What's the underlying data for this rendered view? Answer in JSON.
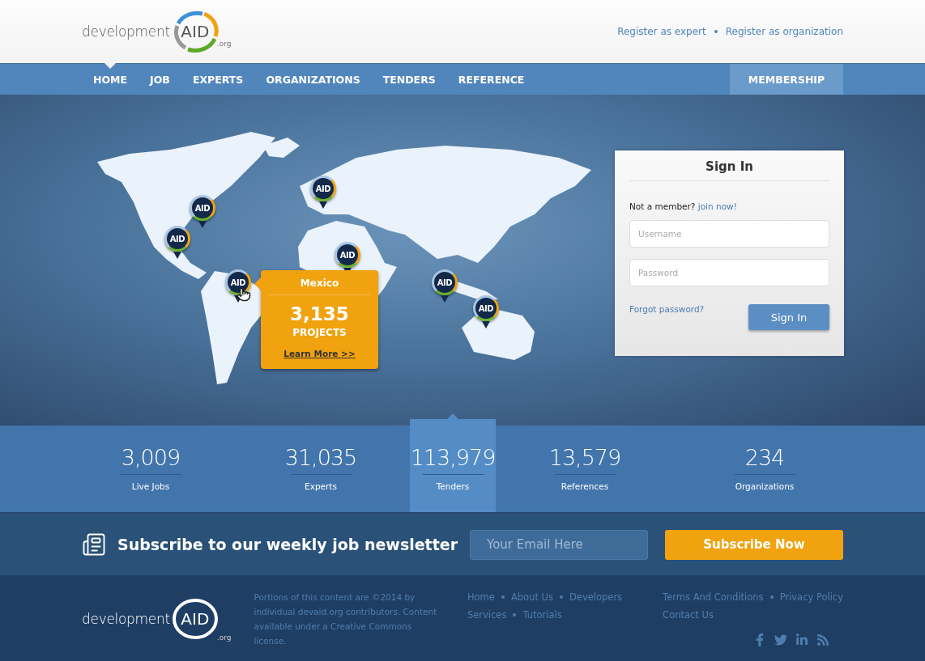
{
  "header": {
    "logo": {
      "word": "development",
      "mark": "AID",
      "suffix": ".org"
    },
    "links": [
      {
        "label": "Register as expert"
      },
      {
        "label": "Register as organization"
      }
    ]
  },
  "nav": {
    "items": [
      {
        "label": "HOME",
        "selected": true
      },
      {
        "label": "JOB",
        "selected": false
      },
      {
        "label": "EXPERTS",
        "selected": false
      },
      {
        "label": "ORGANIZATIONS",
        "selected": false
      },
      {
        "label": "TENDERS",
        "selected": false
      },
      {
        "label": "REFERENCE",
        "selected": false
      }
    ],
    "membership": "MEMBERSHIP"
  },
  "map": {
    "pins": [
      {
        "label": "AID",
        "selected": false
      },
      {
        "label": "AID",
        "selected": false
      },
      {
        "label": "AID",
        "selected": false
      },
      {
        "label": "AID",
        "selected": false
      },
      {
        "label": "AID",
        "selected": true
      },
      {
        "label": "AID",
        "selected": false
      },
      {
        "label": "AID",
        "selected": false
      }
    ],
    "popup": {
      "country": "Mexico",
      "count": "3,135",
      "unit": "PROJECTS",
      "link": "Learn More >>"
    }
  },
  "sign_in": {
    "title": "Sign In",
    "prompt": "Not a member?",
    "join_link": "join now!",
    "username_placeholder": "Username",
    "password_placeholder": "Password",
    "forgot": "Forgot password?",
    "button": "Sign In"
  },
  "stats": [
    {
      "value": "3,009",
      "label": "Live Jobs",
      "selected": false
    },
    {
      "value": "31,035",
      "label": "Experts",
      "selected": false
    },
    {
      "value": "113,979",
      "label": "Tenders",
      "selected": true
    },
    {
      "value": "13,579",
      "label": "References",
      "selected": false
    },
    {
      "value": "234",
      "label": "Organizations",
      "selected": false
    }
  ],
  "newsletter": {
    "title": "Subscribe to our weekly job newsletter",
    "placeholder": "Your Email Here",
    "button": "Subscribe Now"
  },
  "footer": {
    "logo": {
      "word": "development",
      "mark": "AID",
      "suffix": ".org"
    },
    "notice": "Portions of this content are ©2014 by individual devaid.org contributors. Content available under a Creative Commons license.",
    "links_1": [
      [
        "Home",
        "About Us",
        "Developers"
      ],
      [
        "Services",
        "Tutorials"
      ]
    ],
    "links_2": [
      [
        "Terms And Conditions",
        "Privacy Policy"
      ],
      [
        "Contact Us"
      ]
    ]
  }
}
